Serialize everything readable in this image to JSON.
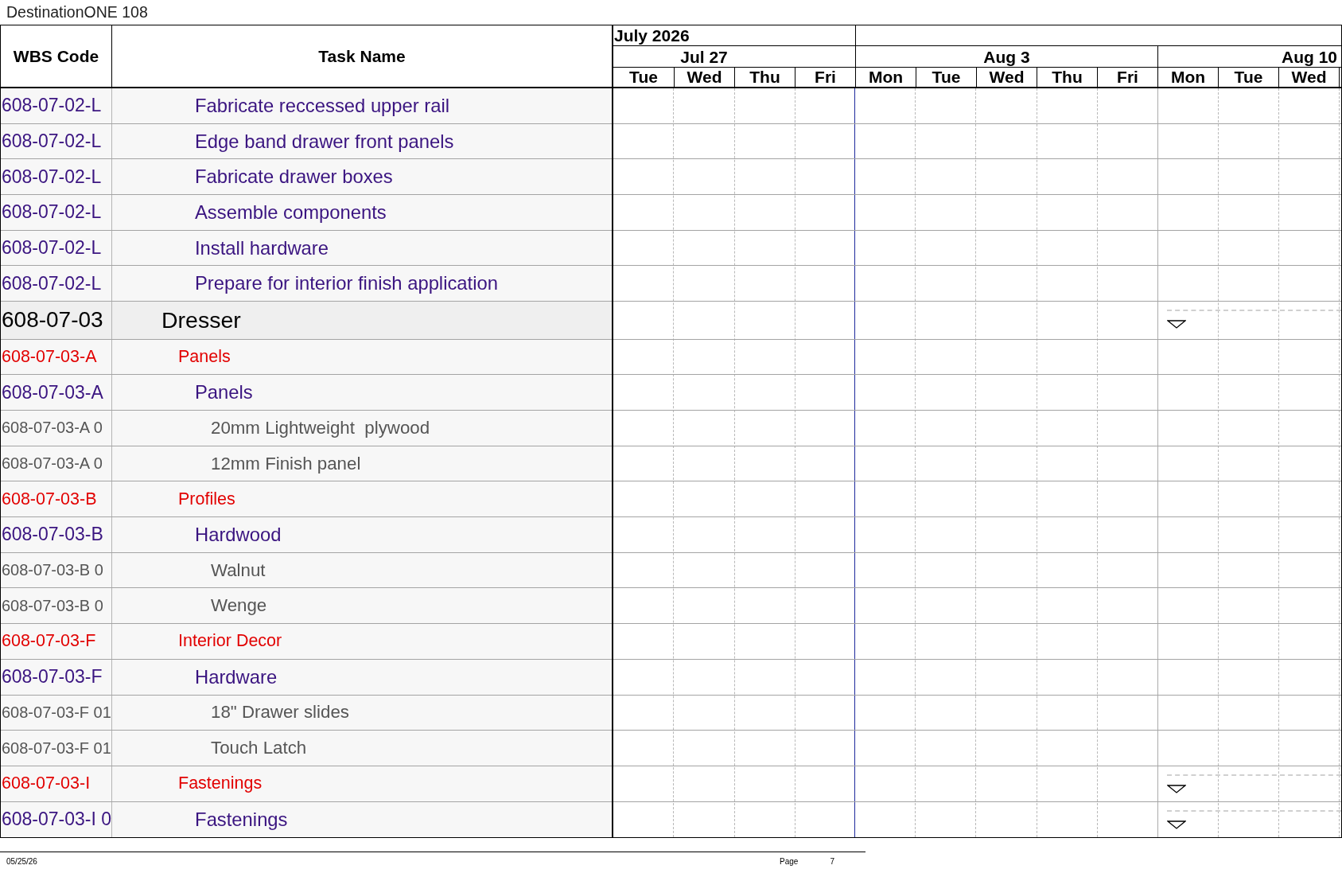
{
  "document": {
    "title": "DestinationONE 108"
  },
  "table": {
    "columns": [
      "WBS Code",
      "Task Name"
    ]
  },
  "timeline": {
    "months": [
      {
        "label": "July 2026",
        "weeks": [
          {
            "label": "Jul 27",
            "date_line": false,
            "days": [
              "Tue",
              "Wed",
              "Thu",
              "Fri"
            ]
          }
        ]
      },
      {
        "weeks": [
          {
            "label": "Aug 3",
            "date_line": true,
            "days": [
              "Mon",
              "Tue",
              "Wed",
              "Thu",
              "Fri"
            ]
          },
          {
            "label": "Aug 10",
            "date_line": false,
            "days": [
              "Mon",
              "Tue",
              "Wed"
            ]
          }
        ]
      }
    ]
  },
  "rows": [
    {
      "kind": "task",
      "wbs": "608-07-02-L",
      "name": "Fabricate reccessed upper rail",
      "summary_bar": false
    },
    {
      "kind": "task",
      "wbs": "608-07-02-L",
      "name": "Edge band drawer front panels",
      "summary_bar": false
    },
    {
      "kind": "task",
      "wbs": "608-07-02-L",
      "name": "Fabricate drawer boxes",
      "summary_bar": false
    },
    {
      "kind": "task",
      "wbs": "608-07-02-L",
      "name": "Assemble components",
      "summary_bar": false
    },
    {
      "kind": "task",
      "wbs": "608-07-02-L",
      "name": "Install hardware",
      "summary_bar": false
    },
    {
      "kind": "task",
      "wbs": "608-07-02-L",
      "name": "Prepare for interior finish application",
      "summary_bar": false
    },
    {
      "kind": "summary",
      "wbs": "608-07-03",
      "name": "Dresser",
      "summary_bar": true,
      "children": [
        {
          "kind": "group",
          "wbs": "608-07-03-A",
          "name": "Panels",
          "summary_bar": false,
          "children": [
            {
              "kind": "task",
              "wbs": "608-07-03-A",
              "name": "Panels",
              "summary_bar": false,
              "children": [
                {
                  "kind": "item",
                  "wbs": "608-07-03-A 0",
                  "name": "20mm Lightweight  plywood",
                  "summary_bar": false
                },
                {
                  "kind": "item",
                  "wbs": "608-07-03-A 0",
                  "name": "12mm Finish panel",
                  "summary_bar": false
                }
              ]
            }
          ]
        },
        {
          "kind": "group",
          "wbs": "608-07-03-B",
          "name": "Profiles",
          "summary_bar": false,
          "children": [
            {
              "kind": "task",
              "wbs": "608-07-03-B",
              "name": "Hardwood",
              "summary_bar": false,
              "children": [
                {
                  "kind": "item",
                  "wbs": "608-07-03-B 0",
                  "name": "Walnut",
                  "summary_bar": false
                },
                {
                  "kind": "item",
                  "wbs": "608-07-03-B 0",
                  "name": "Wenge",
                  "summary_bar": false
                }
              ]
            }
          ]
        },
        {
          "kind": "group",
          "wbs": "608-07-03-F",
          "name": "Interior Decor",
          "summary_bar": false,
          "children": [
            {
              "kind": "task",
              "wbs": "608-07-03-F",
              "name": "Hardware",
              "summary_bar": false,
              "children": [
                {
                  "kind": "item",
                  "wbs": "608-07-03-F 01",
                  "name": "18\" Drawer slides",
                  "summary_bar": false
                },
                {
                  "kind": "item",
                  "wbs": "608-07-03-F 01",
                  "name": "Touch Latch",
                  "summary_bar": false
                }
              ]
            }
          ]
        },
        {
          "kind": "group",
          "wbs": "608-07-03-I",
          "name": "Fastenings",
          "summary_bar": true,
          "children": [
            {
              "kind": "task",
              "wbs": "608-07-03-I 0",
              "name": "Fastenings",
              "summary_bar": true
            }
          ]
        }
      ]
    }
  ],
  "footer": {
    "date": "05/25/26",
    "page_label": "Page",
    "page_number": "7"
  }
}
